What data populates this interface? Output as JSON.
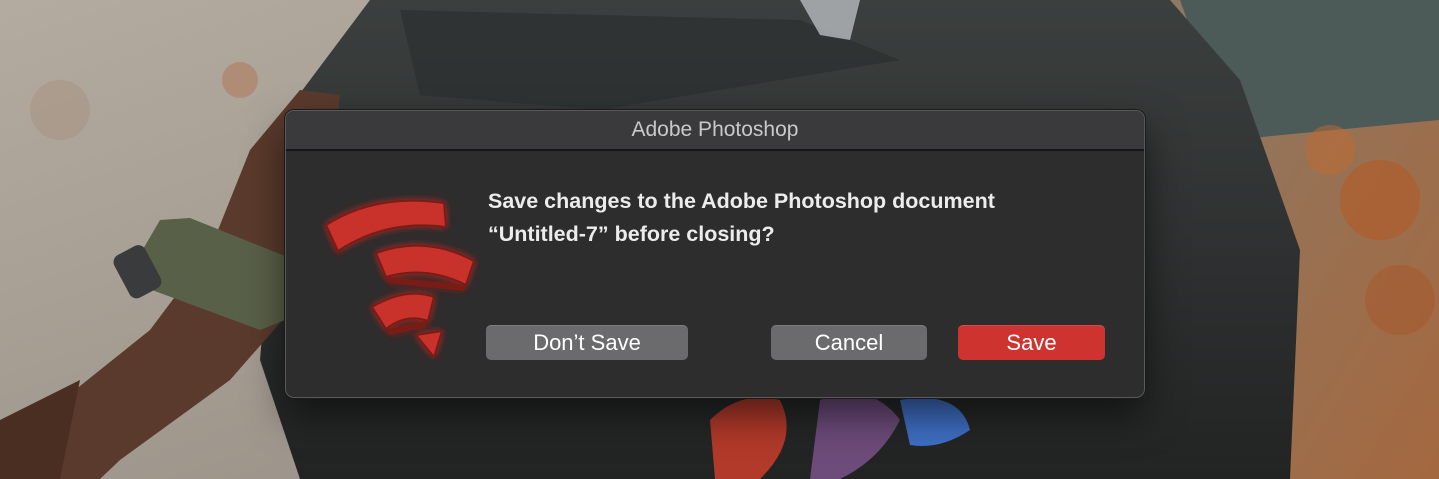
{
  "dialog": {
    "title": "Adobe Photoshop",
    "message_line1": "Save changes to the Adobe Photoshop document",
    "message_line2": "“Untitled-7” before closing?",
    "icon": "wifi-signal-red-icon",
    "buttons": {
      "dont_save": "Don’t Save",
      "cancel": "Cancel",
      "save": "Save"
    }
  },
  "colors": {
    "dialog_bg": "#2d2d2e",
    "titlebar_bg": "#3a3a3c",
    "primary_button": "#cf3330",
    "secondary_button": "#6b6b6d",
    "icon_red": "#c8312b"
  }
}
